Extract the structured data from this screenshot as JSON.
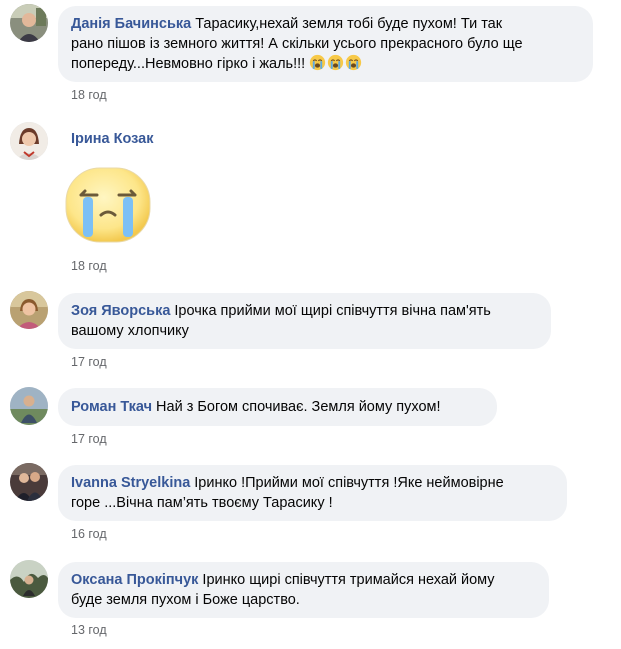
{
  "comments": [
    {
      "author": "Данія Бачинська",
      "text_lines": [
        "Тарасику,нехай земля тобі буде пухом! Ти так",
        "рано пішов із земного життя! А скільки усього прекрасного було ще",
        "попереду...Невмовно гірко і жаль!!!"
      ],
      "emoji": [
        "loudly-crying-face",
        "loudly-crying-face",
        "loudly-crying-face"
      ],
      "time": "18 год"
    },
    {
      "author": "Ірина Козак",
      "sticker": "crying-face-sticker",
      "time": "18 год"
    },
    {
      "author": "Зоя Яворська",
      "text_lines": [
        "Ірочка прийми мої щирі співчуття вічна пам'ять",
        "вашому хлопчику"
      ],
      "time": "17 год"
    },
    {
      "author": "Роман Ткач",
      "text_lines": [
        "Най з Богом спочиває. Земля йому пухом!"
      ],
      "time": "17 год"
    },
    {
      "author": "Ivanna Stryelkina",
      "text_lines": [
        "Іринко !Прийми мої співчуття !Яке неймовірне",
        "горе ...Вічна пам’ять твоєму Тарасику !"
      ],
      "time": "16 год"
    },
    {
      "author": "Оксана Прокіпчук",
      "text_lines": [
        "Іринко щирі співчуття тримайся нехай йому",
        "буде земля пухом і Боже царство."
      ],
      "time": "13 год"
    }
  ]
}
